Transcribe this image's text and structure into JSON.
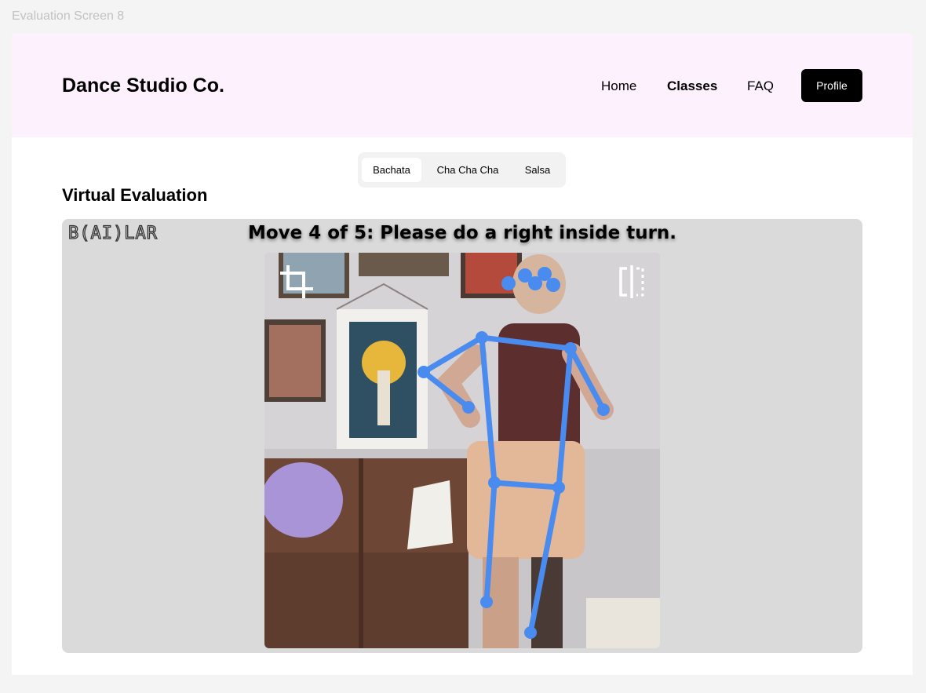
{
  "screen_label": "Evaluation Screen 8",
  "header": {
    "brand": "Dance Studio Co.",
    "nav": {
      "home": "Home",
      "classes": "Classes",
      "faq": "FAQ"
    },
    "active_nav": "Classes",
    "profile_label": "Profile"
  },
  "tabs": {
    "items": [
      "Bachata",
      "Cha Cha Cha",
      "Salsa"
    ],
    "selected": "Bachata"
  },
  "section_title": "Virtual Evaluation",
  "evaluation": {
    "logo_text": "B(AI)LAR",
    "instruction": "Move 4 of 5: Please do a right inside turn.",
    "controls": {
      "crop_icon": "crop-icon",
      "mirror_icon": "mirror-flip-icon"
    },
    "skeleton_color": "#4a8bf0"
  },
  "colors": {
    "header_bg": "#fdf1fd",
    "panel_bg": "#dadada",
    "button_bg": "#000000",
    "accent": "#4a8bf0"
  }
}
